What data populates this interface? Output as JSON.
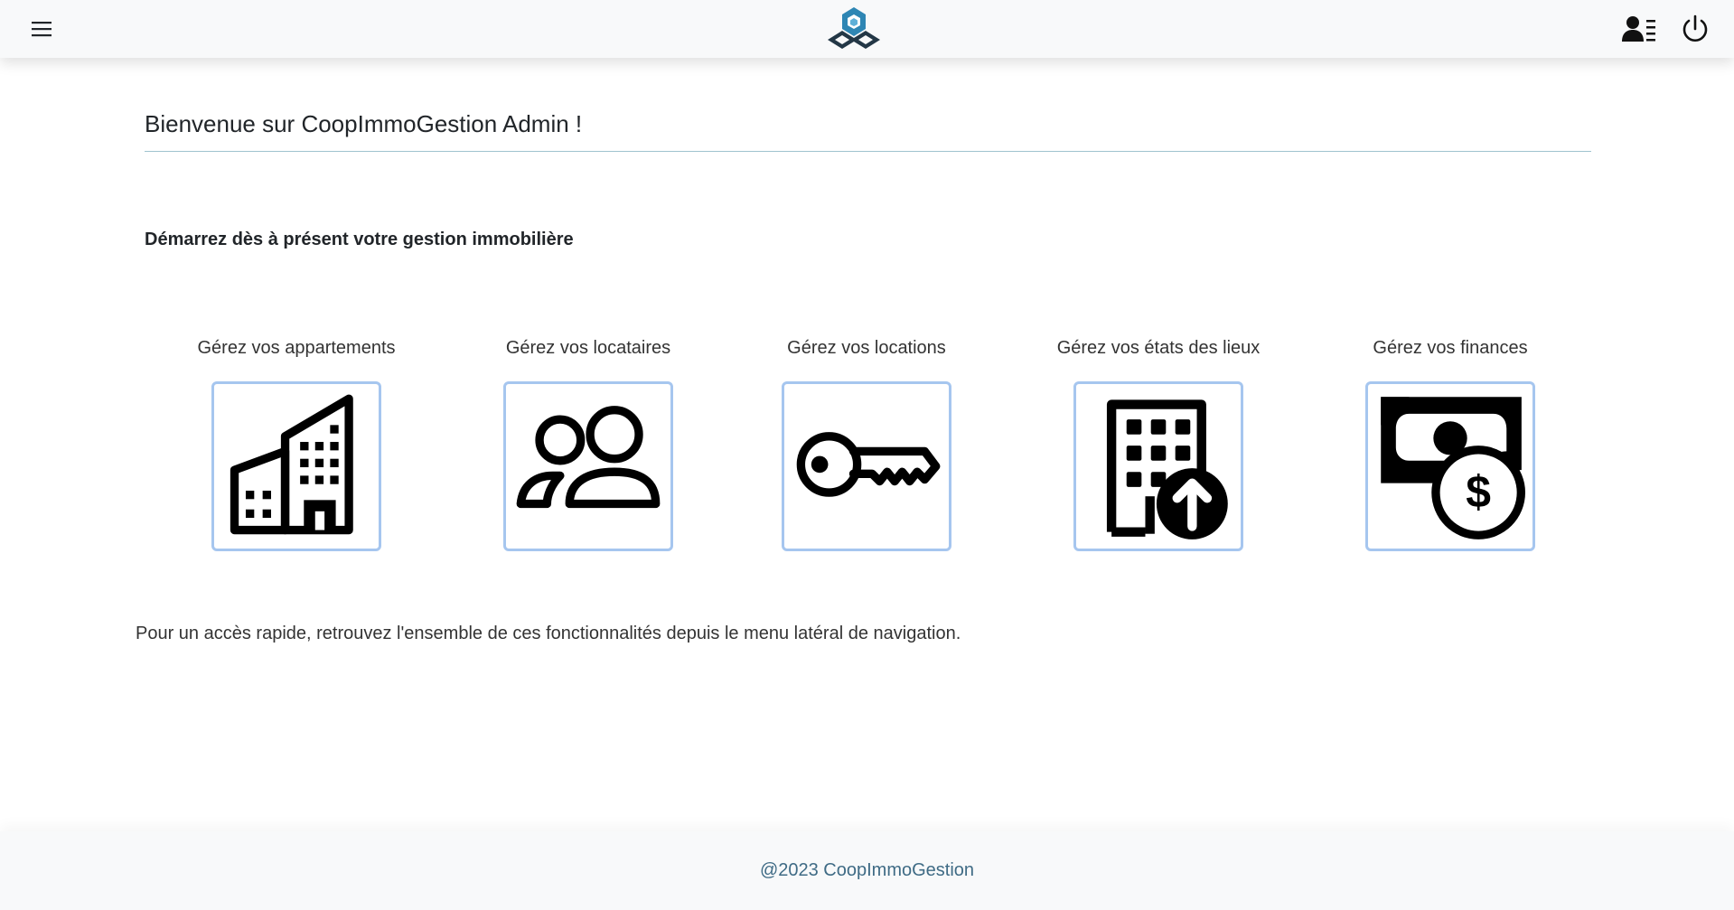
{
  "header": {
    "menu_icon": "hamburger-menu-icon",
    "logo_icon": "coopimmogestion-logo",
    "profile_icon": "user-profile-icon",
    "power_icon": "power-icon"
  },
  "main": {
    "title": "Bienvenue sur CoopImmoGestion Admin !",
    "subtitle": "Démarrez dès à présent votre gestion immobilière",
    "cards": [
      {
        "label": "Gérez vos appartements",
        "icon": "buildings-icon"
      },
      {
        "label": "Gérez vos locataires",
        "icon": "people-icon"
      },
      {
        "label": "Gérez vos locations",
        "icon": "key-icon"
      },
      {
        "label": "Gérez vos états des lieux",
        "icon": "building-upload-icon"
      },
      {
        "label": "Gérez vos finances",
        "icon": "cash-coin-icon"
      }
    ],
    "info": "Pour un accès rapide, retrouvez l'ensemble de ces fonctionnalités depuis le menu latéral de navigation."
  },
  "footer": {
    "text": "@2023 CoopImmoGestion"
  },
  "colors": {
    "navbar_bg": "#f8f9fa",
    "card_border": "#a6c6ef",
    "title_rule": "#9fc3cf",
    "footer_text": "#3f6b85",
    "logo_blue": "#2e86b4"
  }
}
